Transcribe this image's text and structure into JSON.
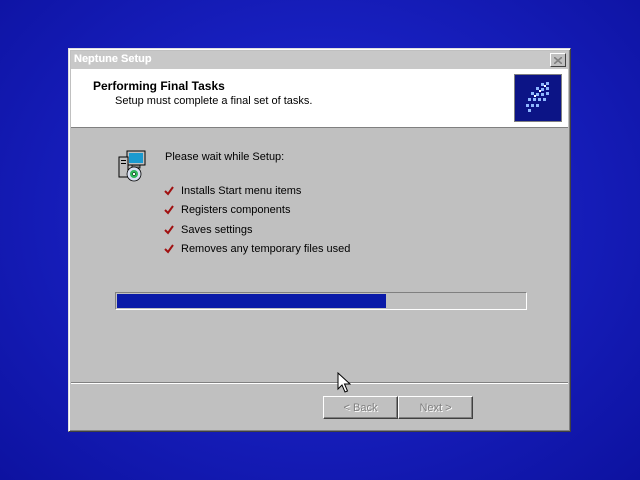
{
  "window": {
    "title": "Neptune Setup"
  },
  "header": {
    "title": "Performing Final Tasks",
    "subtitle": "Setup must complete a final set of tasks."
  },
  "main": {
    "intro": "Please wait while Setup:",
    "tasks": [
      {
        "label": "Installs Start menu items",
        "icon": "check-icon"
      },
      {
        "label": "Registers components",
        "icon": "check-icon"
      },
      {
        "label": "Saves settings",
        "icon": "check-icon"
      },
      {
        "label": "Removes any temporary files used",
        "icon": "check-icon"
      }
    ],
    "progress_fraction": 0.66
  },
  "footer": {
    "back_label": "< Back",
    "next_label": "Next >"
  },
  "colors": {
    "desktop": "#1820c0",
    "progress_fill": "#0a1aa8",
    "check": "#a01010"
  }
}
